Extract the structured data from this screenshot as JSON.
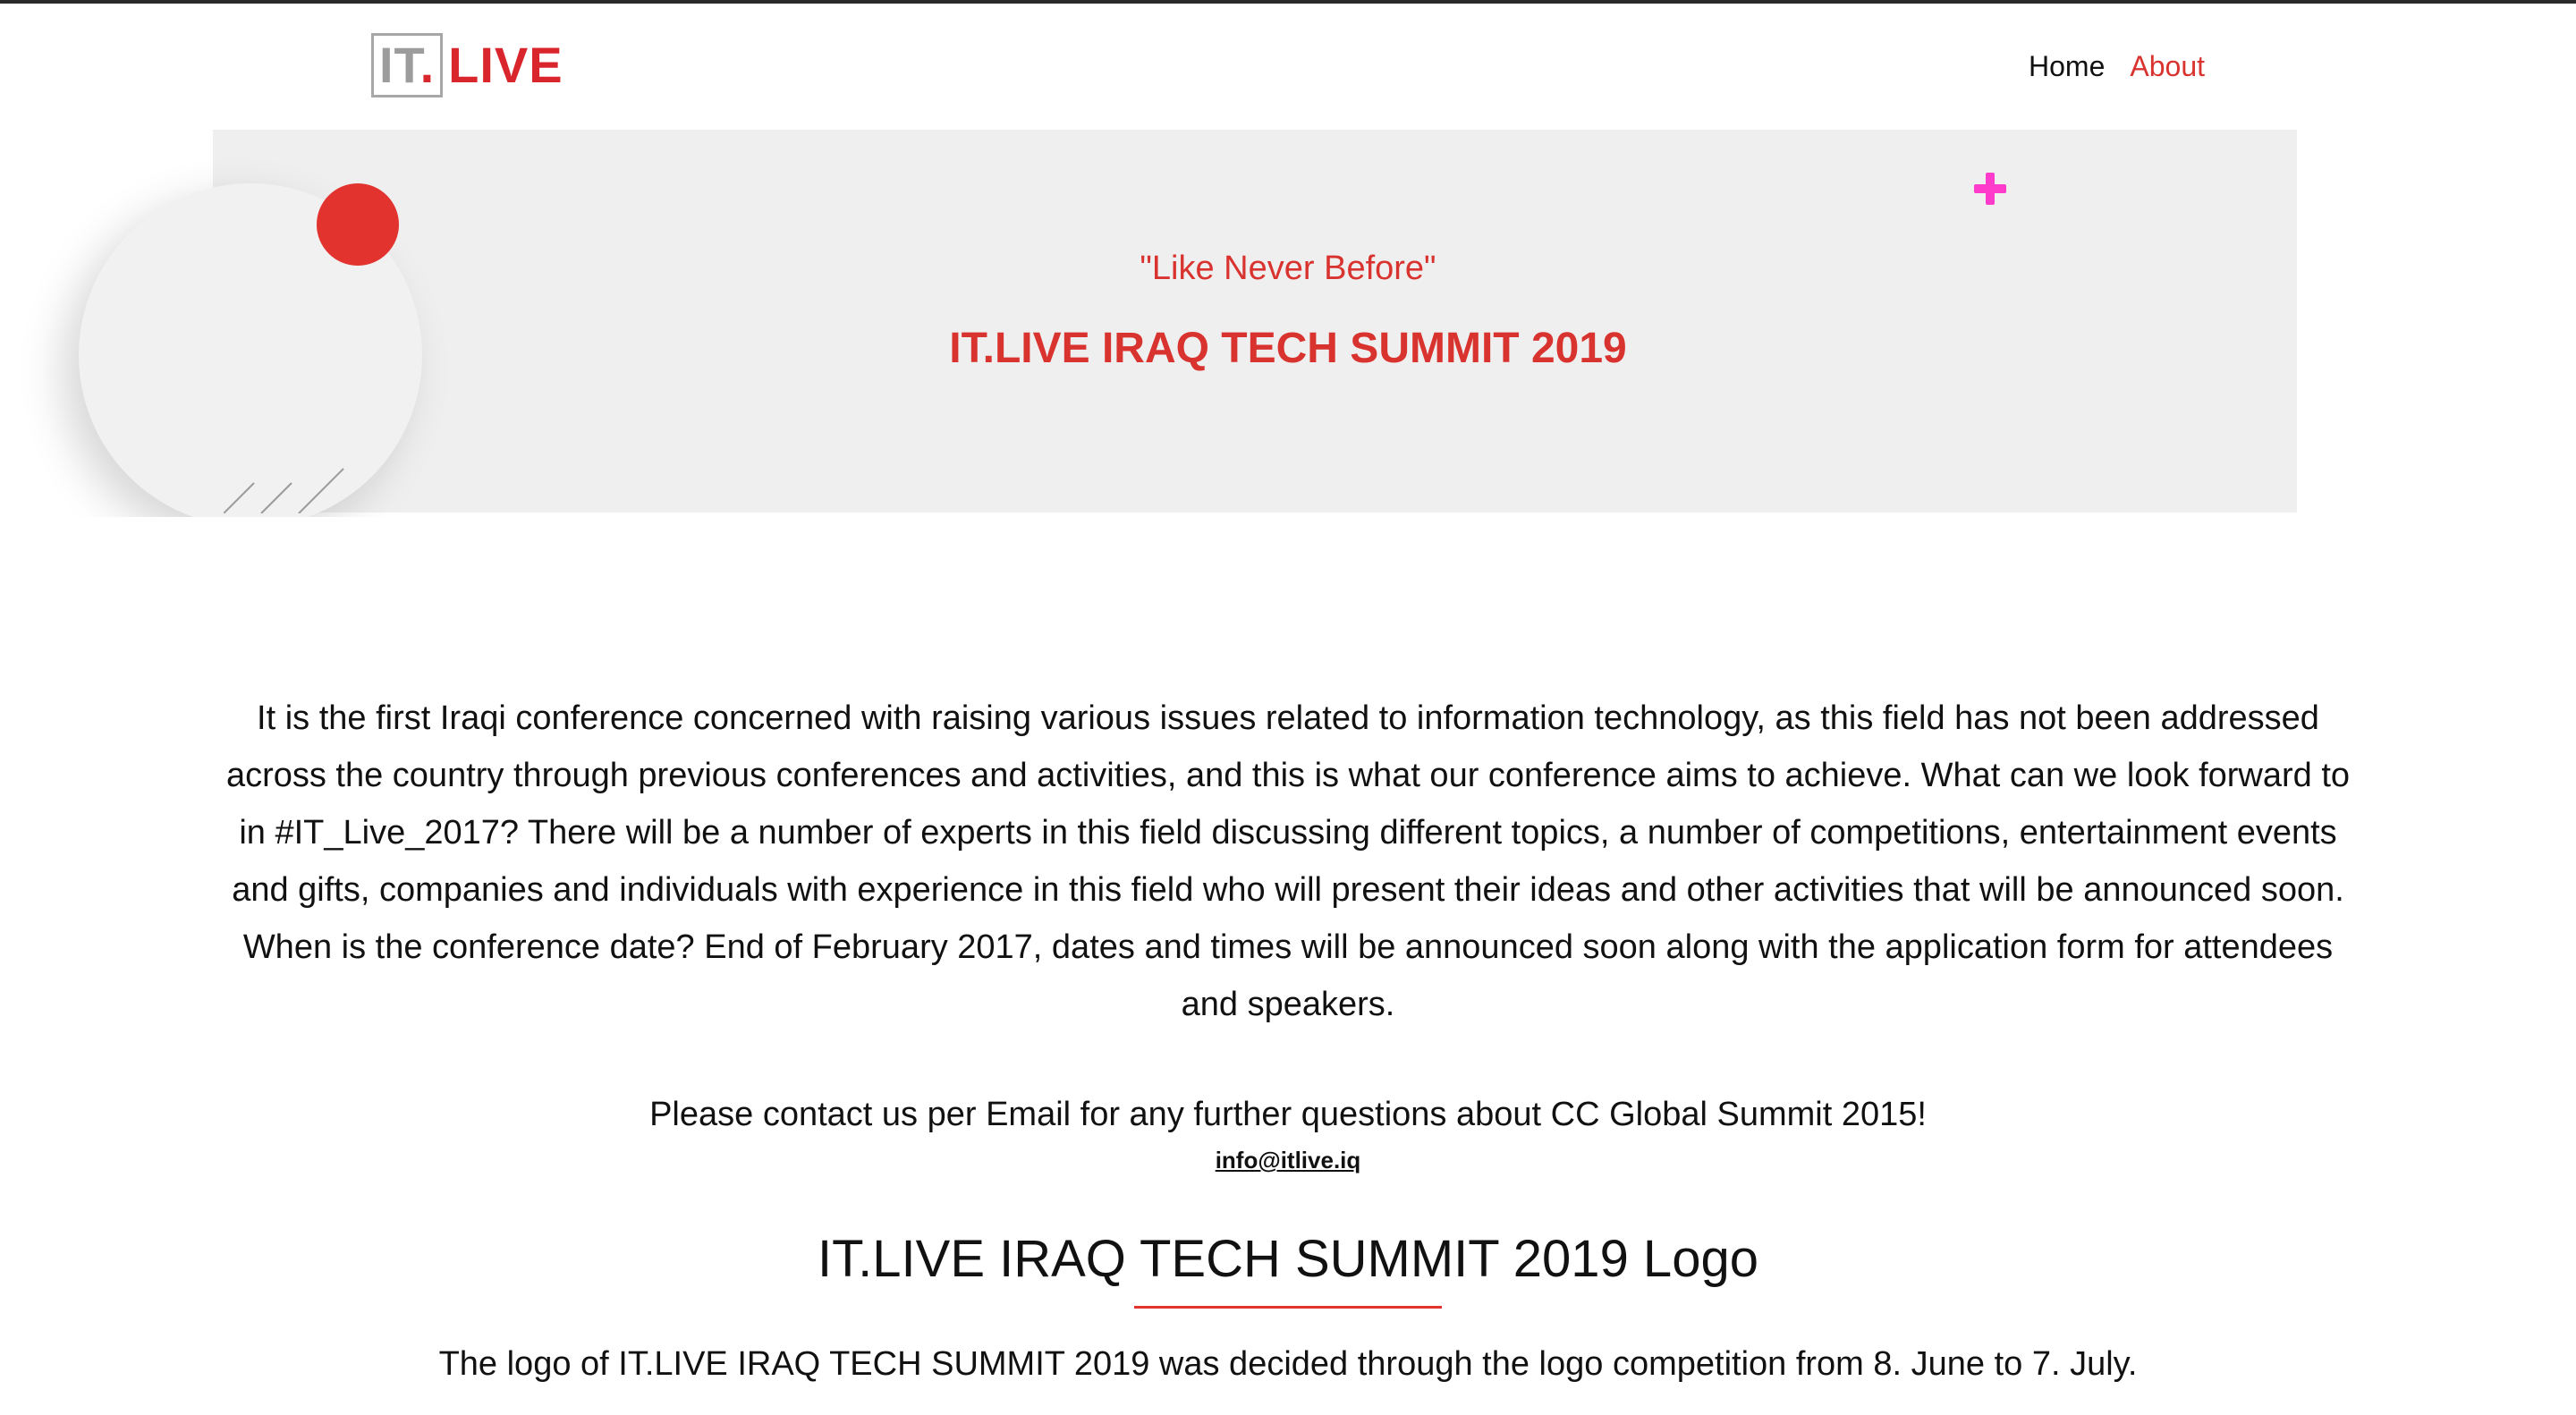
{
  "header": {
    "logo": {
      "part1": "IT",
      "dot": ".",
      "part2": "LIVE"
    },
    "nav": [
      {
        "label": "Home"
      },
      {
        "label": "About"
      }
    ]
  },
  "hero": {
    "tagline": "\"Like Never Before\"",
    "title": "IT.LIVE IRAQ TECH SUMMIT 2019"
  },
  "content": {
    "intro": "It is the first Iraqi conference concerned with raising various issues related to information technology, as this field has not been addressed across the country through previous conferences and activities, and this is what our conference aims to achieve. What can we look forward to in #IT_Live_2017? There will be a number of experts in this field discussing different topics, a number of competitions, entertainment events and gifts, companies and individuals with experience in this field who will present their ideas and other activities that will be announced soon. When is the conference date? End of February 2017, dates and times will be announced soon along with the application form for attendees and speakers.",
    "contact_text": "Please contact us per Email for any further questions about CC Global Summit 2015!",
    "email": "info@itlive.iq"
  },
  "logo_section": {
    "title": "IT.LIVE IRAQ TECH SUMMIT 2019 Logo",
    "text": "The logo of IT.LIVE IRAQ TECH SUMMIT 2019 was decided through the logo competition from 8. June to 7. July."
  },
  "colors": {
    "accent_red": "#d9332f",
    "logo_gray": "#9c9c9c",
    "hero_bg": "#efefef",
    "plus_pink": "#ff3bcb"
  }
}
